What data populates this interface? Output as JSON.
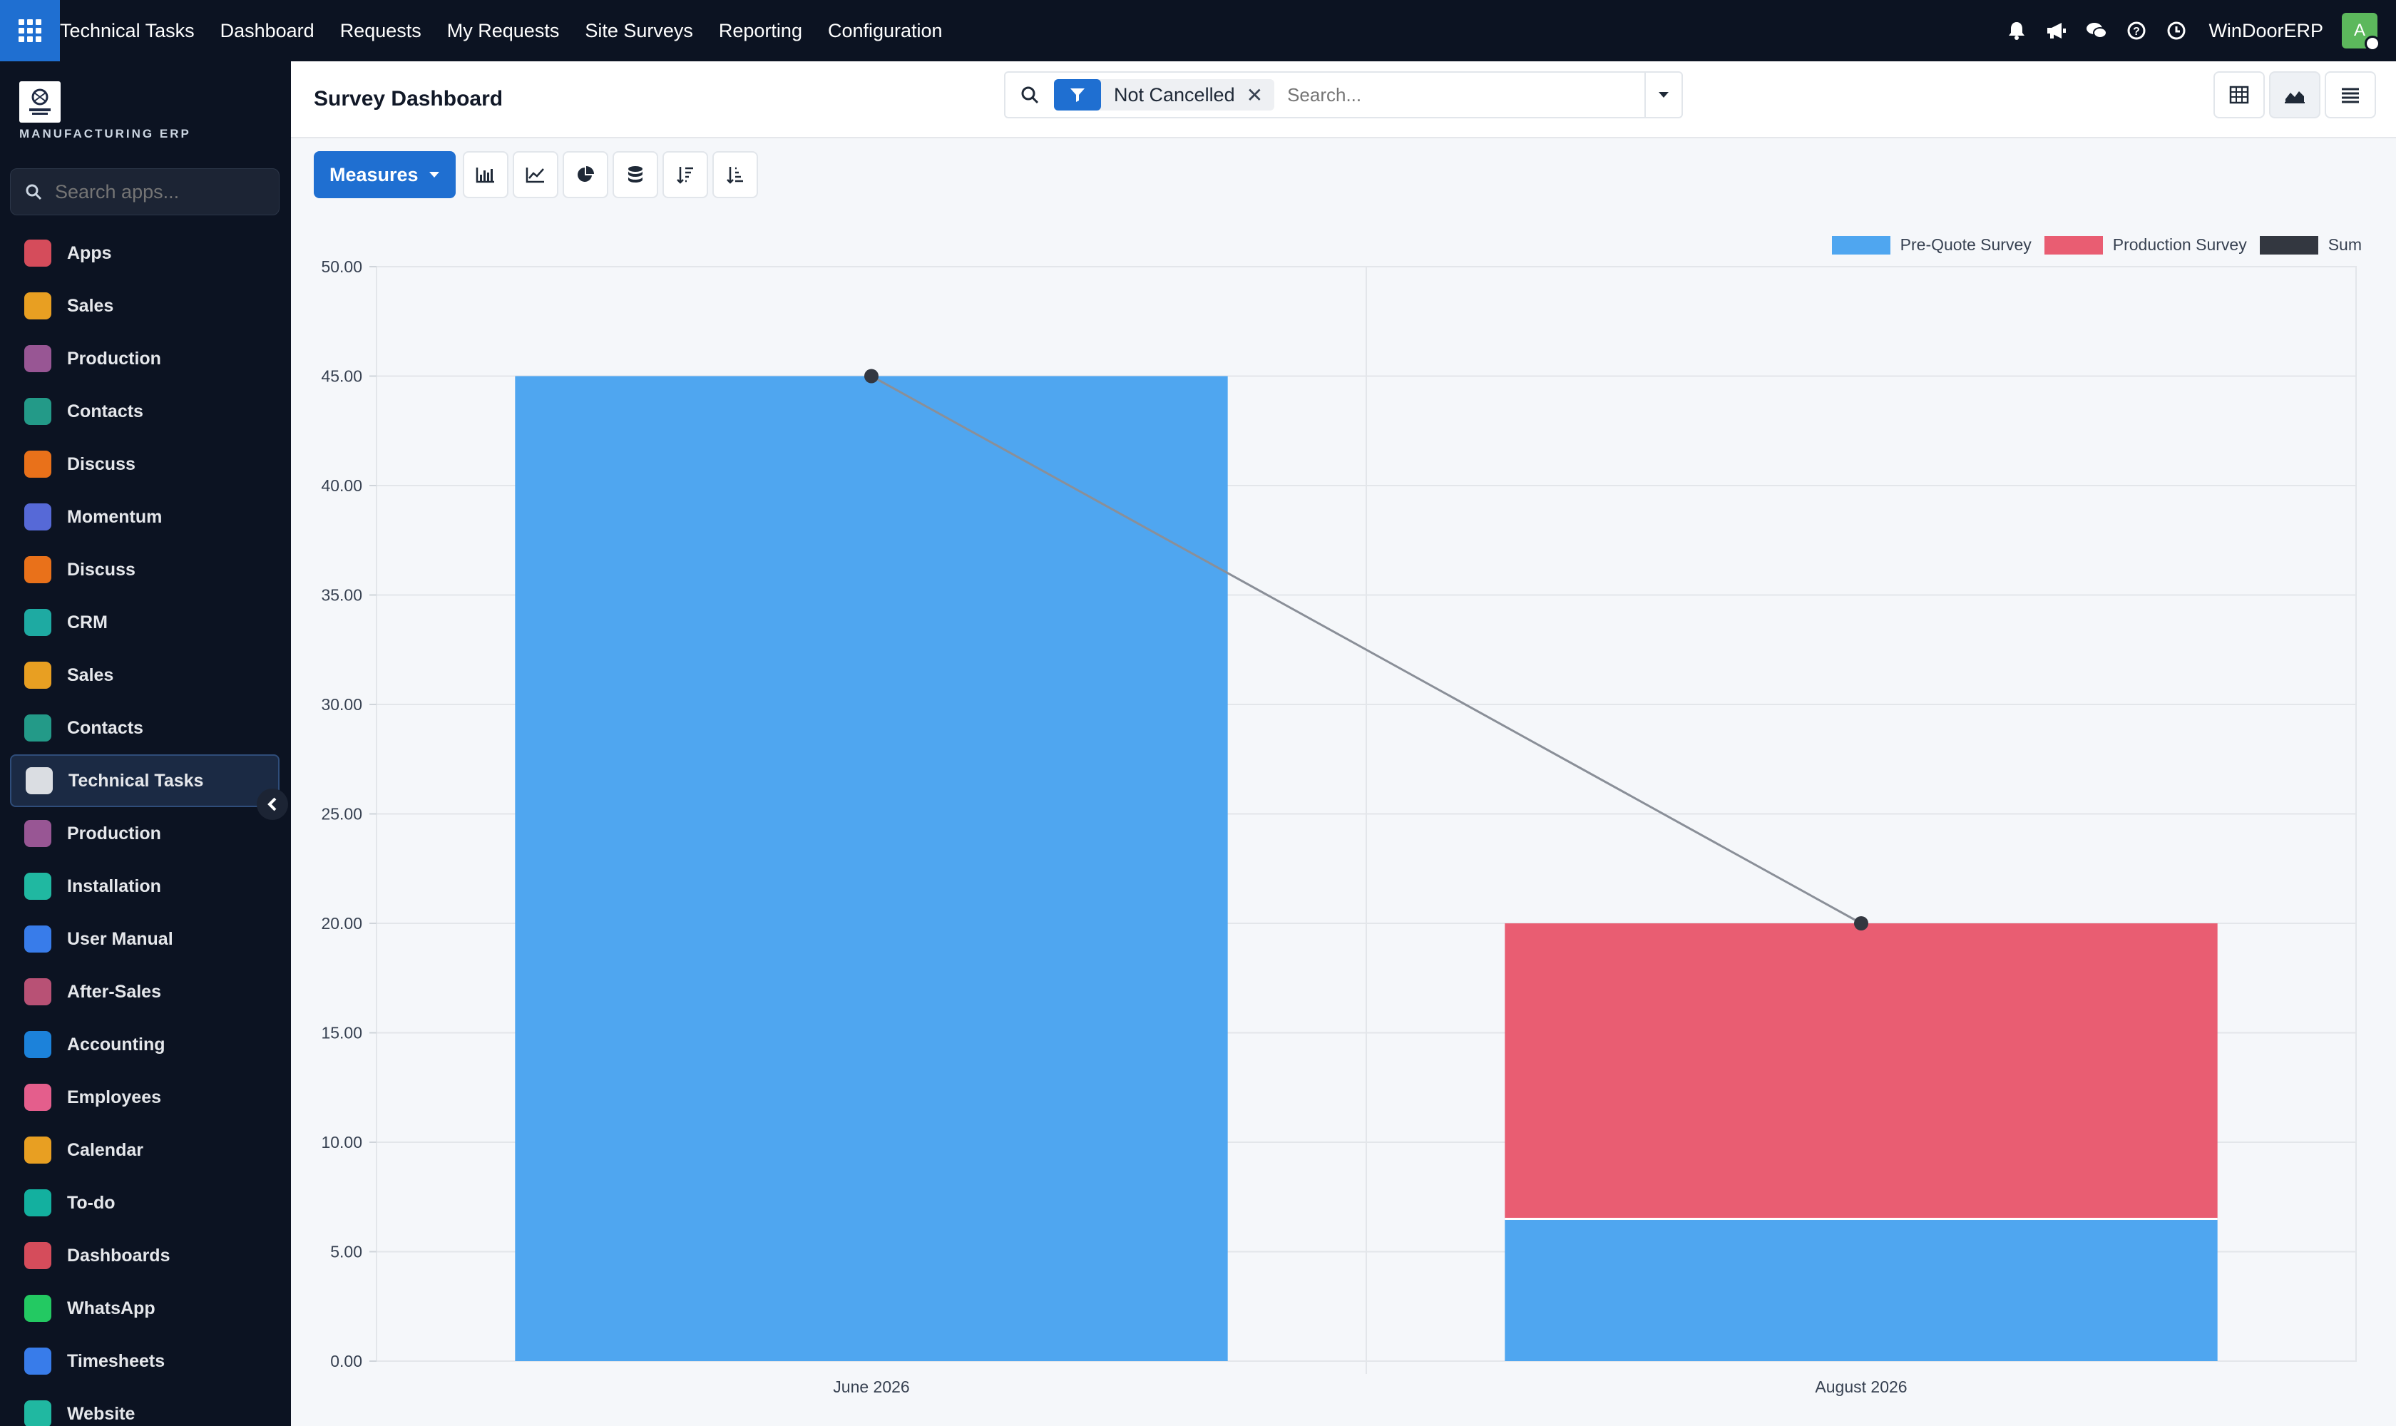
{
  "topbar": {
    "brand": "Technical Tasks",
    "nav": [
      "Dashboard",
      "Requests",
      "My Requests",
      "Site Surveys",
      "Reporting",
      "Configuration"
    ],
    "company": "WinDoorERP",
    "avatar_letter": "A"
  },
  "sidebar": {
    "logo_text": "MANUFACTURING ERP",
    "search_placeholder": "Search apps...",
    "items": [
      {
        "label": "Apps",
        "icon": "apps-icon",
        "color": "#e04f5f"
      },
      {
        "label": "Sales",
        "icon": "sales-icon",
        "color": "#f4a623"
      },
      {
        "label": "Production",
        "icon": "production-icon",
        "color": "#a05a9b"
      },
      {
        "label": "Contacts",
        "icon": "contacts-icon",
        "color": "#25a18e"
      },
      {
        "label": "Discuss",
        "icon": "discuss-icon",
        "color": "#f5761a"
      },
      {
        "label": "Momentum",
        "icon": "momentum-icon",
        "color": "#5b6ee1"
      },
      {
        "label": "Discuss",
        "icon": "discuss-icon",
        "color": "#f5761a"
      },
      {
        "label": "CRM",
        "icon": "crm-icon",
        "color": "#20b2aa"
      },
      {
        "label": "Sales",
        "icon": "sales-icon",
        "color": "#f4a623"
      },
      {
        "label": "Contacts",
        "icon": "contacts-icon",
        "color": "#25a18e"
      },
      {
        "label": "Technical Tasks",
        "icon": "technical-tasks-icon",
        "color": "#e5e7eb"
      },
      {
        "label": "Production",
        "icon": "production-icon",
        "color": "#a05a9b"
      },
      {
        "label": "Installation",
        "icon": "installation-icon",
        "color": "#22c1a9"
      },
      {
        "label": "User Manual",
        "icon": "user-manual-icon",
        "color": "#3b82f6"
      },
      {
        "label": "After-Sales",
        "icon": "after-sales-icon",
        "color": "#c2547a"
      },
      {
        "label": "Accounting",
        "icon": "accounting-icon",
        "color": "#1e88e5"
      },
      {
        "label": "Employees",
        "icon": "employees-icon",
        "color": "#f06292"
      },
      {
        "label": "Calendar",
        "icon": "calendar-icon",
        "color": "#f4a623"
      },
      {
        "label": "To-do",
        "icon": "todo-icon",
        "color": "#14b8a6"
      },
      {
        "label": "Dashboards",
        "icon": "dashboards-icon",
        "color": "#e04f5f"
      },
      {
        "label": "WhatsApp",
        "icon": "whatsapp-icon",
        "color": "#25d366"
      },
      {
        "label": "Timesheets",
        "icon": "timesheets-icon",
        "color": "#3b82f6"
      },
      {
        "label": "Website",
        "icon": "website-icon",
        "color": "#22c1a9"
      }
    ]
  },
  "panel": {
    "title": "Survey Dashboard",
    "filter_facet": "Not Cancelled",
    "search_placeholder": "Search..."
  },
  "toolbar": {
    "measures_label": "Measures"
  },
  "chart_data": {
    "type": "bar",
    "stacked": true,
    "categories": [
      "June 2026",
      "August 2026"
    ],
    "series": [
      {
        "name": "Pre-Quote Survey",
        "values": [
          45,
          6.5
        ],
        "color": "#4fa6f0"
      },
      {
        "name": "Production Survey",
        "values": [
          0,
          13.5
        ],
        "color": "#e95d72"
      }
    ],
    "line_series": {
      "name": "Sum",
      "values": [
        45,
        20
      ],
      "color": "#333740"
    },
    "ylim": [
      0,
      50
    ],
    "yticks": [
      "0.00",
      "5.00",
      "10.00",
      "15.00",
      "20.00",
      "25.00",
      "30.00",
      "35.00",
      "40.00",
      "45.00",
      "50.00"
    ],
    "grid": true,
    "legend_position": "top-right"
  }
}
